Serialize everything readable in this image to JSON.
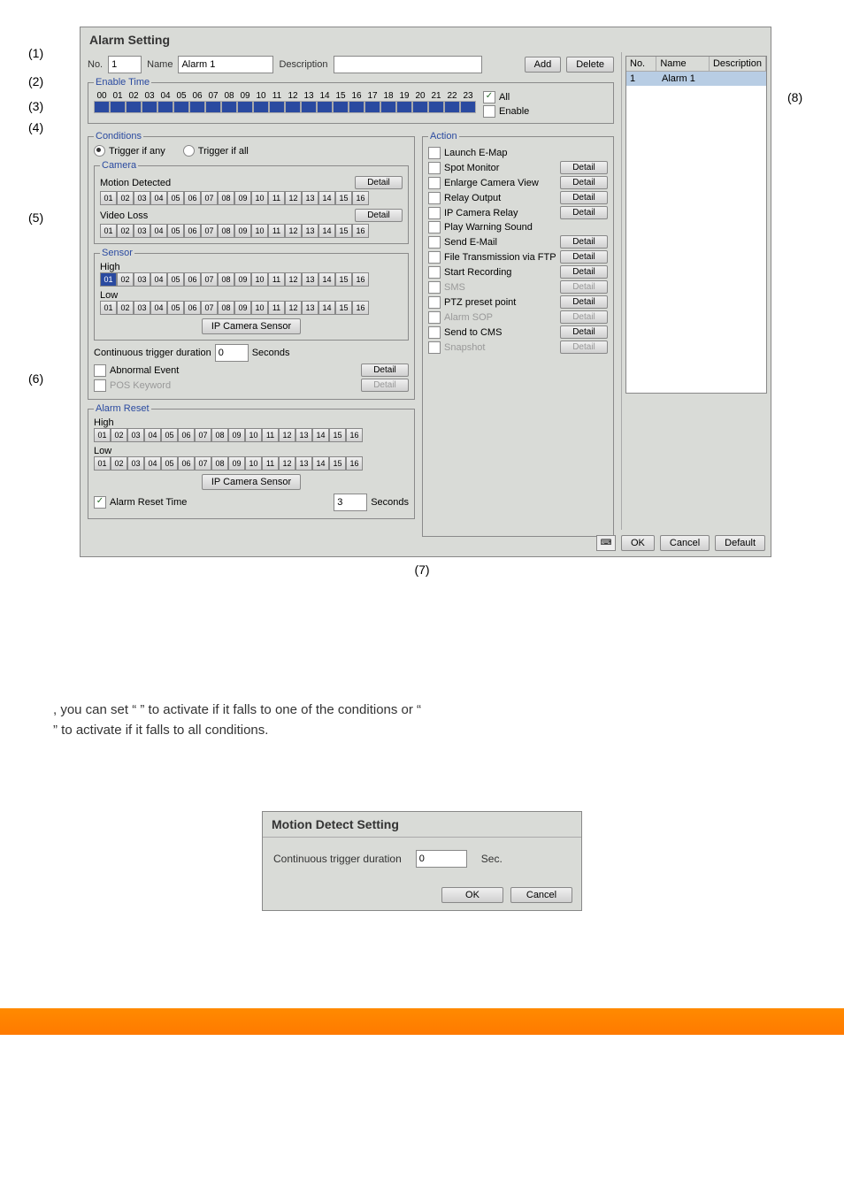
{
  "alarm_dialog": {
    "title": "Alarm Setting",
    "no_label": "No.",
    "no_value": "1",
    "name_label": "Name",
    "name_value": "Alarm 1",
    "description_label": "Description",
    "description_value": "",
    "add_btn": "Add",
    "delete_btn": "Delete",
    "enable_time": {
      "legend": "Enable Time",
      "hours": [
        "00",
        "01",
        "02",
        "03",
        "04",
        "05",
        "06",
        "07",
        "08",
        "09",
        "10",
        "11",
        "12",
        "13",
        "14",
        "15",
        "16",
        "17",
        "18",
        "19",
        "20",
        "21",
        "22",
        "23"
      ],
      "all_label": "All",
      "enable_label": "Enable"
    },
    "conditions": {
      "legend": "Conditions",
      "trigger_any": "Trigger if any",
      "trigger_all": "Trigger if all",
      "camera_legend": "Camera",
      "motion_detected": "Motion Detected",
      "video_loss": "Video Loss",
      "channels": [
        "01",
        "02",
        "03",
        "04",
        "05",
        "06",
        "07",
        "08",
        "09",
        "10",
        "11",
        "12",
        "13",
        "14",
        "15",
        "16"
      ],
      "sensor_legend": "Sensor",
      "sensor_high": "High",
      "sensor_low": "Low",
      "ip_cam_sensor": "IP Camera Sensor",
      "cont_trigger": "Continuous trigger duration",
      "cont_trigger_val": "0",
      "seconds": "Seconds",
      "abnormal_event": "Abnormal Event",
      "pos_keyword": "POS Keyword",
      "detail": "Detail"
    },
    "alarm_reset": {
      "legend": "Alarm Reset",
      "high": "High",
      "low": "Low",
      "ip_cam_sensor": "IP Camera Sensor",
      "reset_time_label": "Alarm Reset Time",
      "reset_time_value": "3",
      "seconds": "Seconds"
    },
    "action": {
      "legend": "Action",
      "launch_emap": "Launch E-Map",
      "spot_monitor": "Spot Monitor",
      "enlarge_cam": "Enlarge Camera View",
      "relay_output": "Relay Output",
      "ip_cam_relay": "IP Camera Relay",
      "play_warn": "Play Warning Sound",
      "send_email": "Send E-Mail",
      "file_ftp": "File Transmission via FTP",
      "start_record": "Start Recording",
      "sms": "SMS",
      "ptz_preset": "PTZ preset point",
      "alarm_sop": "Alarm SOP",
      "send_cms": "Send to CMS",
      "snapshot": "Snapshot",
      "detail": "Detail"
    },
    "side_list": {
      "col_no": "No.",
      "col_name": "Name",
      "col_desc": "Description",
      "row1_no": "1",
      "row1_name": "Alarm 1",
      "row1_desc": ""
    },
    "buttons": {
      "ok": "OK",
      "cancel": "Cancel",
      "default": "Default"
    }
  },
  "callouts": {
    "c1": "(1)",
    "c2": "(2)",
    "c3": "(3)",
    "c4": "(4)",
    "c5": "(5)",
    "c6": "(6)",
    "c7": "(7)",
    "c8": "(8)"
  },
  "doc_text": {
    "t1": ", you can set “",
    "t2": "” to activate if it falls to one of the conditions or “",
    "t3": "” to activate if it falls to all conditions."
  },
  "motion_dialog": {
    "title": "Motion Detect Setting",
    "label": "Continuous trigger duration",
    "value": "0",
    "sec": "Sec.",
    "ok": "OK",
    "cancel": "Cancel"
  }
}
